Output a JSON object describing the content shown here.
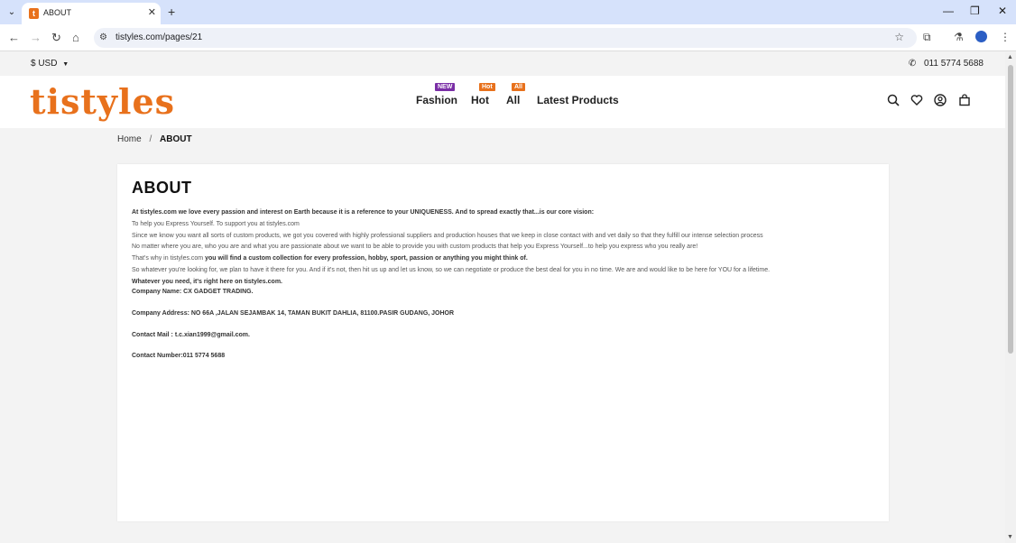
{
  "browser": {
    "tab_title": "ABOUT",
    "favicon_letter": "t",
    "url": "tistyles.com/pages/21",
    "new_tab_label": "+",
    "tab_close_label": "✕"
  },
  "topbar": {
    "currency": "$ USD",
    "phone": "011 5774 5688"
  },
  "header": {
    "logo": "tistyles",
    "menu": [
      {
        "label": "Fashion",
        "badge": "NEW"
      },
      {
        "label": "Hot",
        "badge": "Hot"
      },
      {
        "label": "All",
        "badge": "All"
      },
      {
        "label": "Latest Products",
        "badge": ""
      }
    ]
  },
  "breadcrumb": {
    "home": "Home",
    "separator": "/",
    "current": "ABOUT"
  },
  "about": {
    "title": "ABOUT",
    "p1": "At tistyles.com we love every passion and interest on Earth because it is a reference to your UNIQUENESS. And to spread exactly that...is our core vision:",
    "p2": "To help you Express Yourself. To support you at tistyles.com",
    "p3": "Since we know you want all sorts of custom products, we got you covered with highly professional suppliers and production houses that we keep in close contact with and vet daily so that they fulfill our intense selection process",
    "p4": "No matter where you are, who you are and what you are passionate about we want to be able to provide you with custom products that help you Express Yourself...to help you express who you really are!",
    "p5_a": "That's why in tistyles.com ",
    "p5_b": "you will find a custom collection for every profession, hobby, sport, passion or anything you might think of.",
    "p6": "So whatever you're looking for, we plan to have it there for you. And if it's not, then hit us up and let us know, so we can negotiate or produce the best deal for you in no time. We are and would like to be here for YOU for a lifetime.",
    "p7": "Whatever you need, it's right here on tistyles.com.",
    "company_name": "Company Name: CX GADGET TRADING.",
    "company_address": "Company Address: NO 66A ,JALAN SEJAMBAK 14, TAMAN BUKIT DAHLIA, 81100.PASIR GUDANG, JOHOR",
    "contact_mail": "Contact Mail : t.c.xian1999@gmail.com.",
    "contact_number": "Contact Number:011 5774 5688"
  },
  "colors": {
    "brand": "#e8711c",
    "badge_new": "#7a2ea6",
    "tabstrip": "#d6e2fb"
  }
}
